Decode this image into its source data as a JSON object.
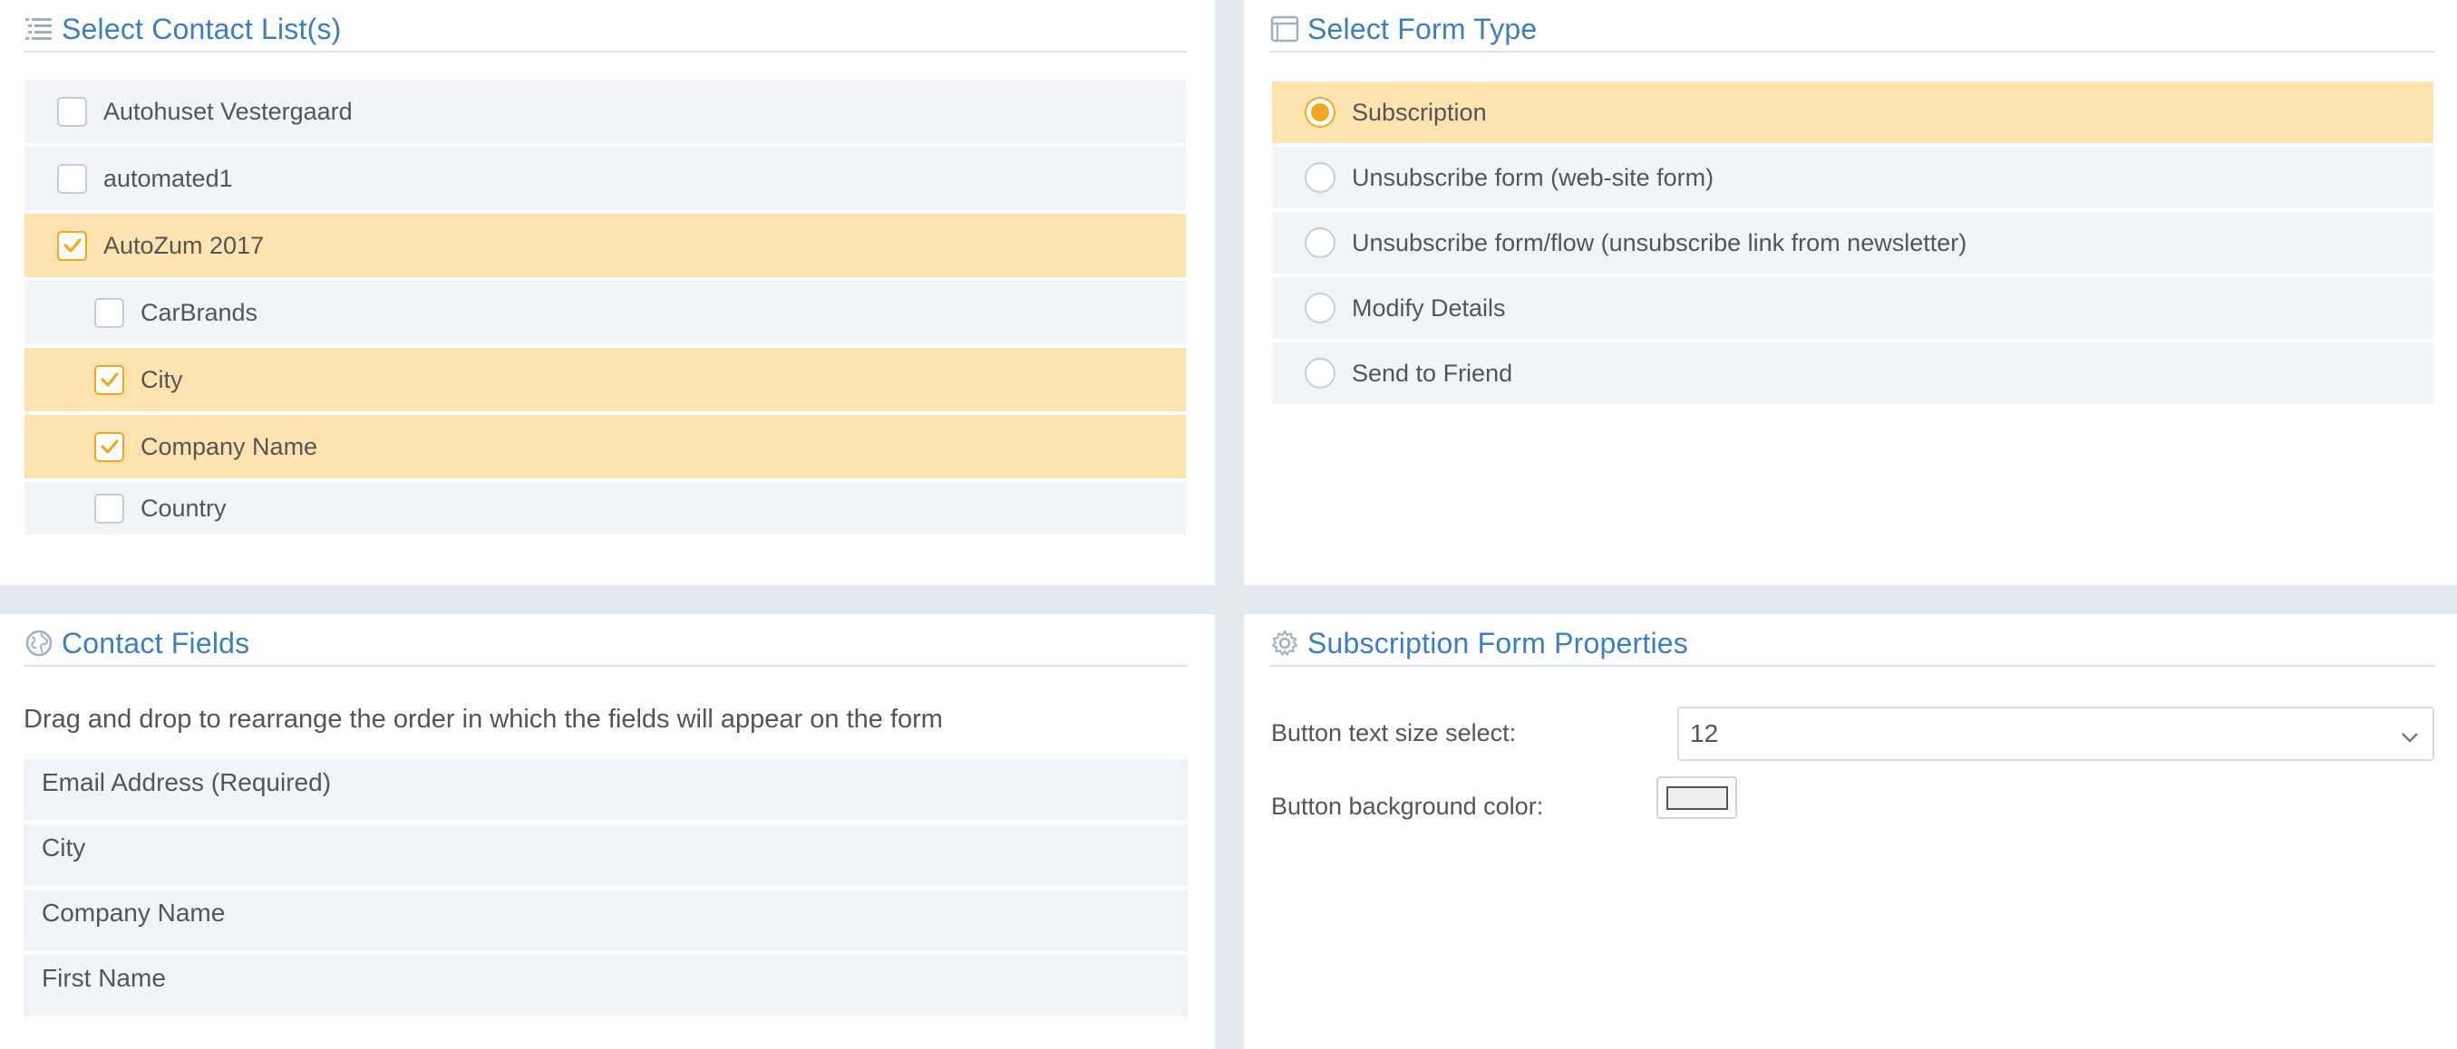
{
  "contact_lists": {
    "title": "Select Contact List(s)",
    "icon": "list-icon",
    "items": [
      {
        "label": "Autohuset Vestergaard",
        "checked": false,
        "level": 0
      },
      {
        "label": "automated1",
        "checked": false,
        "level": 0
      },
      {
        "label": "AutoZum 2017",
        "checked": true,
        "level": 0
      },
      {
        "label": "CarBrands",
        "checked": false,
        "level": 1
      },
      {
        "label": "City",
        "checked": true,
        "level": 1
      },
      {
        "label": "Company Name",
        "checked": true,
        "level": 1
      },
      {
        "label": "Country",
        "checked": false,
        "level": 1
      }
    ]
  },
  "form_type": {
    "title": "Select Form Type",
    "icon": "window-icon",
    "options": [
      {
        "label": "Subscription",
        "selected": true
      },
      {
        "label": "Unsubscribe form (web-site form)",
        "selected": false
      },
      {
        "label": "Unsubscribe form/flow (unsubscribe link from newsletter)",
        "selected": false
      },
      {
        "label": "Modify Details",
        "selected": false
      },
      {
        "label": "Send to Friend",
        "selected": false
      }
    ]
  },
  "contact_fields": {
    "title": "Contact Fields",
    "icon": "globe-icon",
    "description": "Drag and drop to rearrange the order in which the fields will appear on the form",
    "fields": [
      "Email Address (Required)",
      "City",
      "Company Name",
      "First Name"
    ]
  },
  "properties": {
    "title": "Subscription Form Properties",
    "icon": "gear-icon",
    "text_size_label": "Button text size select:",
    "text_size_value": "12",
    "bg_color_label": "Button background color:",
    "bg_color_value": "#eeeeee"
  },
  "colors": {
    "accent": "#3a7ec4",
    "selected_row": "#fde3b0",
    "check": "#f4a61c",
    "row": "#f1f4f8"
  }
}
